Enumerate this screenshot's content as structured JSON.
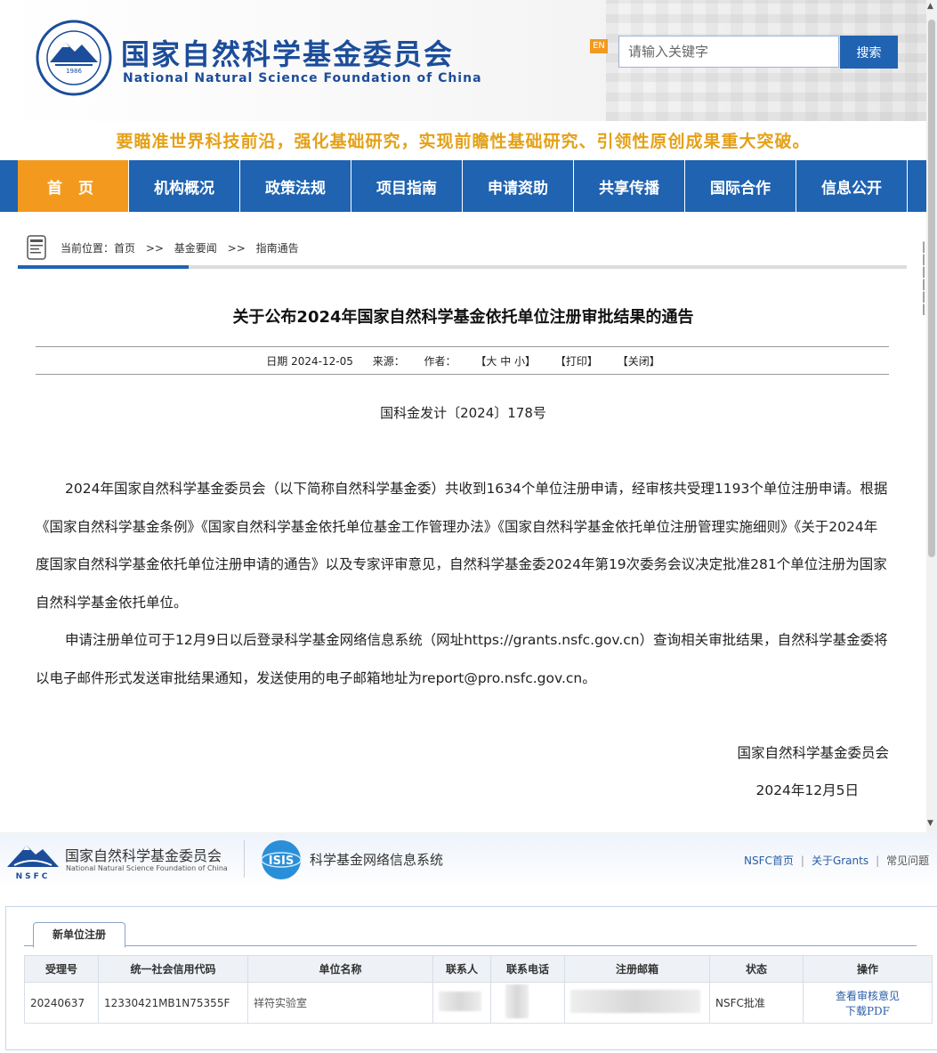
{
  "header": {
    "brand_cn": "国家自然科学基金委员会",
    "brand_en": "National Natural Science Foundation of China",
    "seal_year": "1986",
    "en_badge": "EN",
    "search_placeholder": "请输入关键字",
    "search_button": "搜索"
  },
  "slogan": "要瞄准世界科技前沿，强化基础研究，实现前瞻性基础研究、引领性原创成果重大突破。",
  "nav": [
    "首 页",
    "机构概况",
    "政策法规",
    "项目指南",
    "申请资助",
    "共享传播",
    "国际合作",
    "信息公开"
  ],
  "breadcrumb": {
    "label": "当前位置：",
    "items": [
      "首页",
      "基金要闻",
      "指南通告"
    ],
    "sep": ">>"
  },
  "article": {
    "title": "关于公布2024年国家自然科学基金依托单位注册审批结果的通告",
    "meta": {
      "date": "日期 2024-12-05",
      "source": "来源：",
      "author": "作者：",
      "font_size": "【大 中 小】",
      "print": "【打印】",
      "close": "【关闭】"
    },
    "doc_number": "国科金发计〔2024〕178号",
    "paragraphs": [
      "2024年国家自然科学基金委员会（以下简称自然科学基金委）共收到1634个单位注册申请，经审核共受理1193个单位注册申请。根据《国家自然科学基金条例》《国家自然科学基金依托单位基金工作管理办法》《国家自然科学基金依托单位注册管理实施细则》《关于2024年度国家自然科学基金依托单位注册申请的通告》以及专家评审意见，自然科学基金委2024年第19次委务会议决定批准281个单位注册为国家自然科学基金依托单位。",
      "申请注册单位可于12月9日以后登录科学基金网络信息系统（网址https://grants.nsfc.gov.cn）查询相关审批结果，自然科学基金委将以电子邮件形式发送审批结果通知，发送使用的电子邮箱地址为report@pro.nsfc.gov.cn。"
    ],
    "signature": "国家自然科学基金委员会",
    "sign_date": "2024年12月5日"
  },
  "system": {
    "logo_text": "NSFC",
    "brand_cn": "国家自然科学基金委员会",
    "brand_en": "National Natural Science Foundation of China",
    "isis_logo": "ISIS",
    "title": "科学基金网络信息系统",
    "links": [
      "NSFC首页",
      "关于Grants",
      "常见问题"
    ],
    "tab": "新单位注册",
    "columns": [
      "受理号",
      "统一社会信用代码",
      "单位名称",
      "联系人",
      "联系电话",
      "注册邮箱",
      "状态",
      "操作"
    ],
    "row": {
      "id": "20240637",
      "credit_code": "12330421MB1N75355F",
      "unit_name": "祥符实验室",
      "status": "NSFC批准",
      "action_view": "查看审核意见",
      "action_download": "下载PDF"
    }
  }
}
